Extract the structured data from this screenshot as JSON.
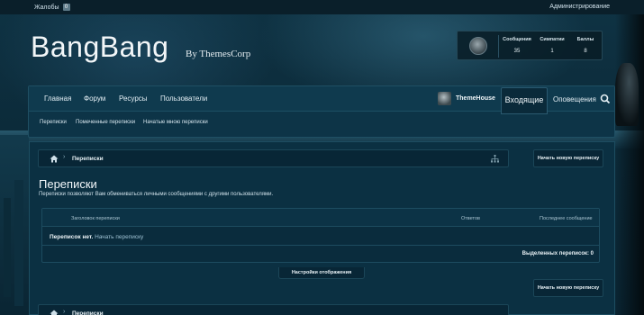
{
  "topbar": {
    "complaints": "Жалобы",
    "complaints_badge": "0",
    "admin": "Администрирование"
  },
  "header": {
    "logo": "BangBang",
    "logo_by": "By ThemesCorp",
    "stats": {
      "messages_label": "Сообщения",
      "messages_value": "35",
      "likes_label": "Симпатии",
      "likes_value": "1",
      "points_label": "Баллы",
      "points_value": "8"
    }
  },
  "nav": {
    "items": [
      {
        "label": "Главная"
      },
      {
        "label": "Форум"
      },
      {
        "label": "Ресурсы"
      },
      {
        "label": "Пользователи"
      }
    ],
    "username": "ThemeHouse",
    "inbox": "Входящие",
    "alerts": "Оповещения",
    "subnav": [
      {
        "label": "Переписки"
      },
      {
        "label": "Помеченные переписки"
      },
      {
        "label": "Начатые мною переписки"
      }
    ]
  },
  "breadcrumb": {
    "current": "Переписки"
  },
  "actions": {
    "new_conversation": "Начать новую переписку",
    "display_settings": "Настройки отображения"
  },
  "page": {
    "title": "Переписки",
    "description": "Переписки позволяют Вам обмениваться личными сообщениями с другими пользователями."
  },
  "table": {
    "col_title": "Заголовок переписки",
    "col_replies": "Ответов",
    "col_last": "Последнее сообщение",
    "empty_text": "Переписок нет.",
    "empty_link": "Начать переписку",
    "selected_label": "Выделенных переписок:",
    "selected_count": "0"
  }
}
